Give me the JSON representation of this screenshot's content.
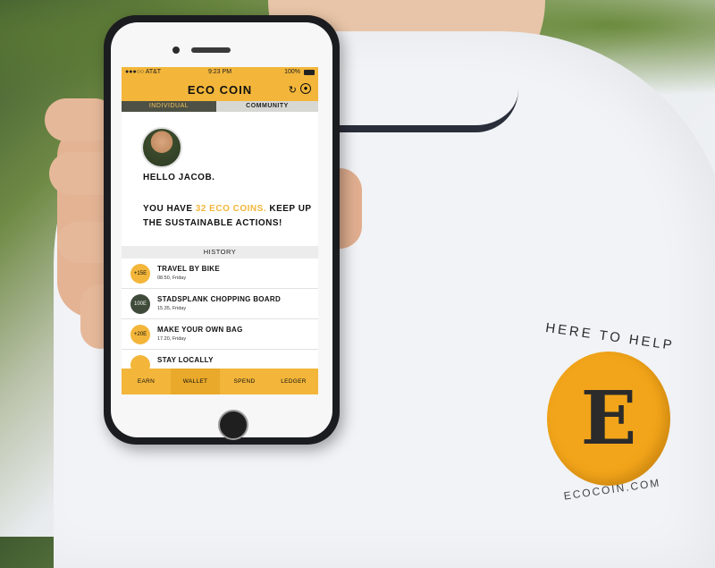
{
  "status_bar": {
    "carrier": "●●●○○ AT&T",
    "time": "9:23 PM",
    "battery": "100%"
  },
  "app": {
    "title": "ECO COIN"
  },
  "tabs": [
    {
      "label": "INDIVIDUAL",
      "active": true
    },
    {
      "label": "COMMUNITY",
      "active": false
    }
  ],
  "profile": {
    "greeting": "HELLO JACOB.",
    "coins_prefix": "YOU HAVE ",
    "coins_highlight": "32 ECO COINS.",
    "coins_suffix": " KEEP UP THE SUSTAINABLE ACTIONS!"
  },
  "history": {
    "header": "HISTORY",
    "items": [
      {
        "badge": "+15E",
        "badge_color": "#f3b63a",
        "title": "TRAVEL BY BIKE",
        "time": "08.50, Friday"
      },
      {
        "badge": "100E",
        "badge_color": "#3f4a3a",
        "title": "STADSPLANK CHOPPING BOARD",
        "time": "15.35, Friday"
      },
      {
        "badge": "+20E",
        "badge_color": "#f3b63a",
        "title": "MAKE YOUR OWN BAG",
        "time": "17.20, Friday"
      },
      {
        "badge": "",
        "badge_color": "#f3b63a",
        "title": "STAY LOCALLY",
        "time": ""
      }
    ]
  },
  "bottom_nav": [
    {
      "label": "EARN",
      "active": false
    },
    {
      "label": "WALLET",
      "active": true
    },
    {
      "label": "SPEND",
      "active": false
    },
    {
      "label": "LEDGER",
      "active": false
    }
  ],
  "shirt_logo": {
    "top_text": "HERE TO HELP",
    "letter": "E",
    "bottom_text": "ECOCOIN.COM"
  },
  "colors": {
    "accent": "#f3b63a",
    "dark_tab": "#4d5145",
    "light_tab": "#d7d8d3"
  }
}
